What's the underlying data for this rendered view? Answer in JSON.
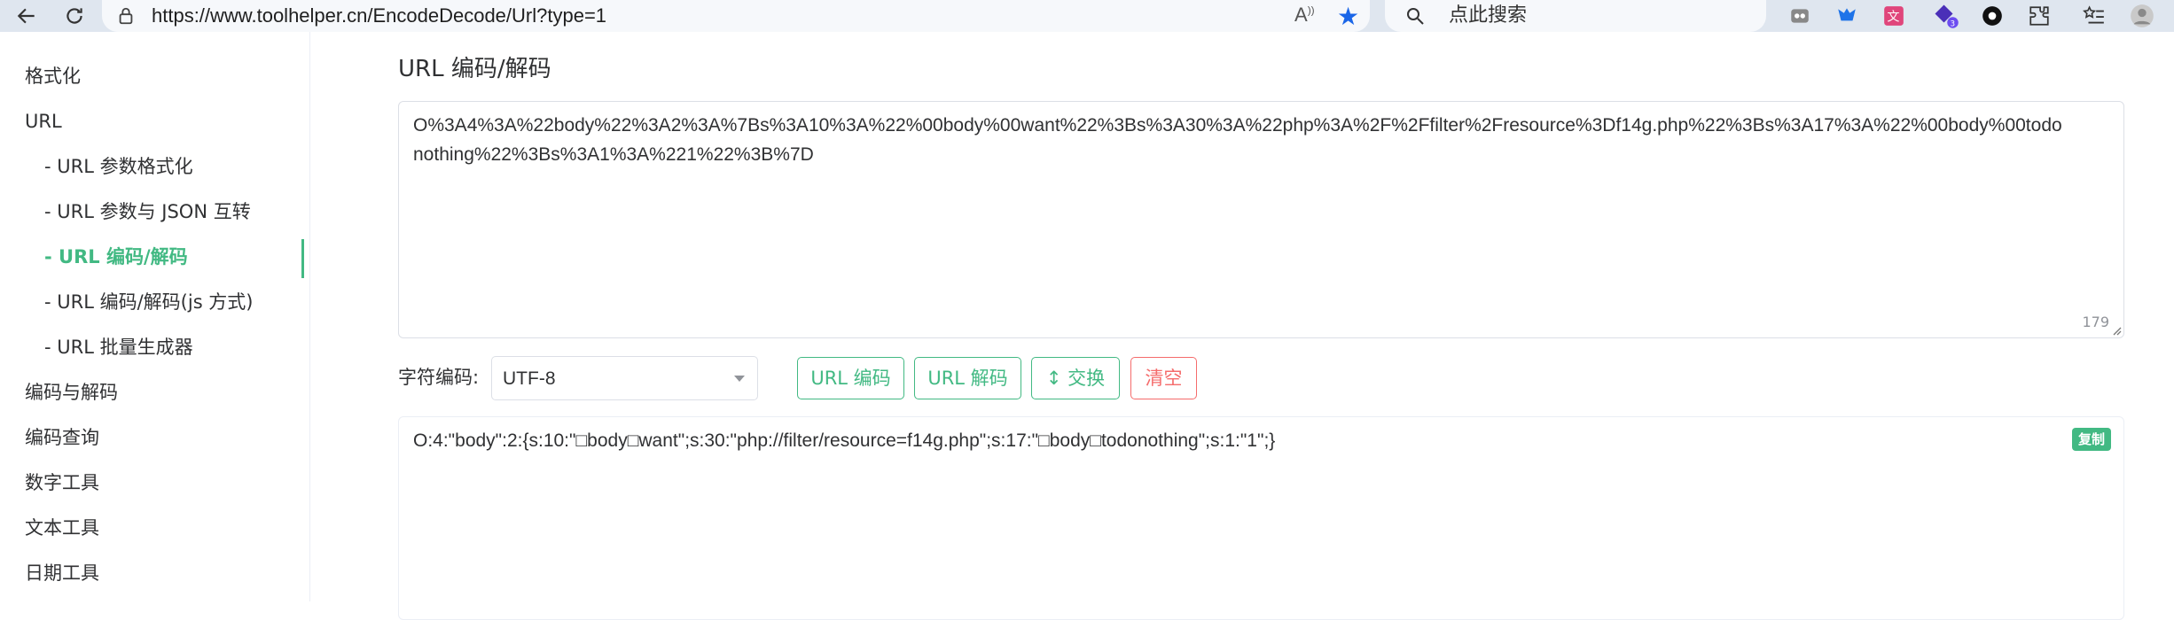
{
  "browser": {
    "url": "https://www.toolhelper.cn/EncodeDecode/Url?type=1",
    "search_placeholder": "点此搜索",
    "read_aloud_label": "Ȃ",
    "extension_badge": "3"
  },
  "sidebar": {
    "items": [
      {
        "label": "格式化"
      },
      {
        "label": "URL"
      },
      {
        "label": "- URL 参数格式化"
      },
      {
        "label": "- URL 参数与 JSON 互转"
      },
      {
        "label": "- URL  编码/解码"
      },
      {
        "label": "- URL  编码/解码(js 方式)"
      },
      {
        "label": "- URL 批量生成器"
      },
      {
        "label": "编码与解码"
      },
      {
        "label": "编码查询"
      },
      {
        "label": "数字工具"
      },
      {
        "label": "文本工具"
      },
      {
        "label": "日期工具"
      }
    ],
    "accent_color": "#42b983"
  },
  "main": {
    "title": "URL 编码/解码",
    "input_value": "O%3A4%3A%22body%22%3A2%3A%7Bs%3A10%3A%22%00body%00want%22%3Bs%3A30%3A%22php%3A%2F%2Ffilter%2Fresource%3Df14g.php%22%3Bs%3A17%3A%22%00body%00todonothing%22%3Bs%3A1%3A%221%22%3B%7D",
    "char_count": "179",
    "charset_label": "字符编码:",
    "charset_value": "UTF-8",
    "buttons": {
      "encode": "URL 编码",
      "decode": "URL 解码",
      "swap": "↕ 交换",
      "clear": "清空"
    },
    "output_value": "O:4:\"body\":2:{s:10:\"□body□want\";s:30:\"php://filter/resource=f14g.php\";s:17:\"□body□todonothing\";s:1:\"1\";}",
    "copy_label": "复制"
  }
}
